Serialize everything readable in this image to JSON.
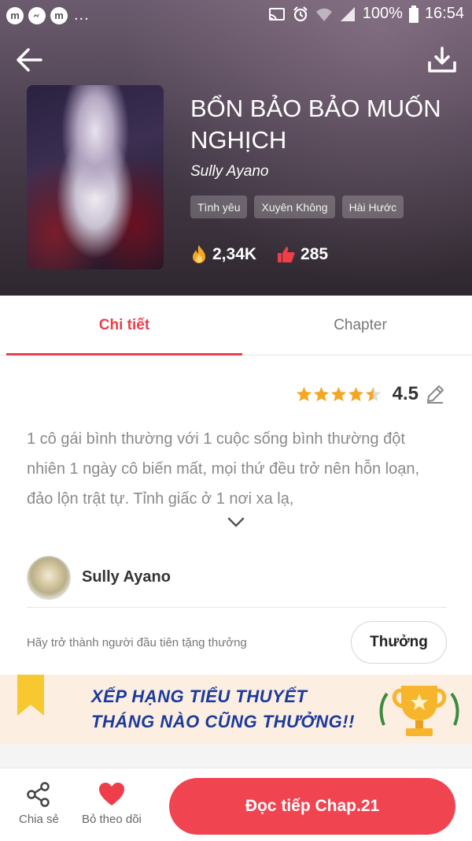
{
  "status_bar": {
    "app_icons": [
      "m",
      "m",
      "m"
    ],
    "more": "...",
    "battery": "100%",
    "time": "16:54"
  },
  "book": {
    "title": "BỔN BẢO BẢO MUỐN NGHỊCH",
    "author": "Sully Ayano",
    "tags": [
      "Tình yêu",
      "Xuyên Không",
      "Hài Hước"
    ],
    "views": "2,34K",
    "likes": "285"
  },
  "tabs": [
    {
      "label": "Chi tiết",
      "active": true
    },
    {
      "label": "Chapter",
      "active": false
    }
  ],
  "rating": {
    "value": "4.5",
    "stars": 4.5
  },
  "description": "1 cô gái bình thường với 1 cuộc sống bình thường đột nhiên 1 ngày cô biến mất, mọi thứ đều trở nên hỗn loạn, đảo lộn trật tự. Tỉnh giấc ở 1 nơi xa lạ,",
  "author_section": {
    "name": "Sully Ayano"
  },
  "reward": {
    "text": "Hãy trở thành người đầu tiên tặng thưởng",
    "button_label": "Thưởng"
  },
  "banner": {
    "line1": "XẾP HẠNG TIỂU THUYẾT",
    "line2": "THÁNG NÀO CŨNG THƯỞNG!!"
  },
  "bottom_bar": {
    "share_label": "Chia sẻ",
    "follow_label": "Bỏ theo dõi",
    "read_label": "Đọc tiếp Chap.21"
  },
  "colors": {
    "accent": "#ef3e4a",
    "star": "#f5a623",
    "banner_text": "#1a3a9c"
  }
}
